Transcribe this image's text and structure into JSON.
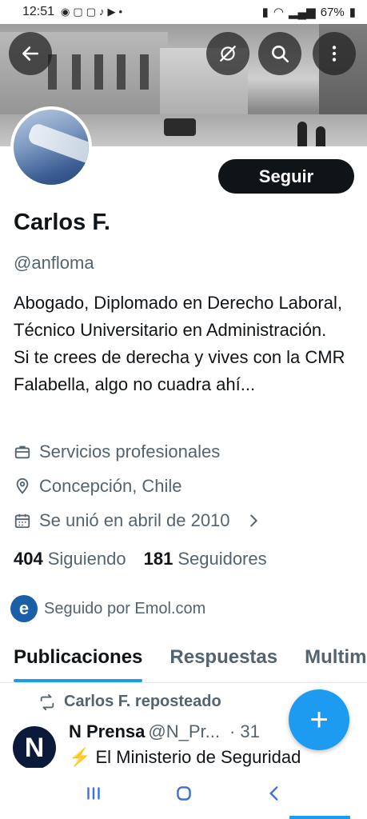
{
  "status_bar": {
    "time": "12:51",
    "app_icons": [
      "messenger-icon",
      "instagram-icon",
      "instagram-icon",
      "tiktok-icon",
      "youtube-icon",
      "dot-icon"
    ],
    "battery": "67%"
  },
  "profile": {
    "name": "Carlos F.",
    "handle": "@anfloma",
    "bio": "Abogado, Diplomado en Derecho Laboral, Técnico Universitario en Administración. Si te crees de derecha y vives con la CMR Falabella, algo no cuadra ahí...",
    "follow_label": "Seguir",
    "category": "Servicios profesionales",
    "location": "Concepción, Chile",
    "joined": "Se unió en abril de 2010",
    "following_count": "404",
    "following_label": "Siguiendo",
    "followers_count": "181",
    "followers_label": "Seguidores",
    "followed_by": "Seguido por Emol.com"
  },
  "tabs": [
    {
      "label": "Publicaciones",
      "active": true
    },
    {
      "label": "Respuestas",
      "active": false
    },
    {
      "label": "Multimedia",
      "active": false
    }
  ],
  "feed": {
    "repost_label": "Carlos F. reposteado",
    "author_name": "N Prensa",
    "author_handle": "@N_Pr...",
    "date": "· 31",
    "text": "⚡ El Ministerio de Seguridad"
  },
  "colors": {
    "accent": "#1d9bf0",
    "text": "#0f1419",
    "secondary": "#536471"
  }
}
